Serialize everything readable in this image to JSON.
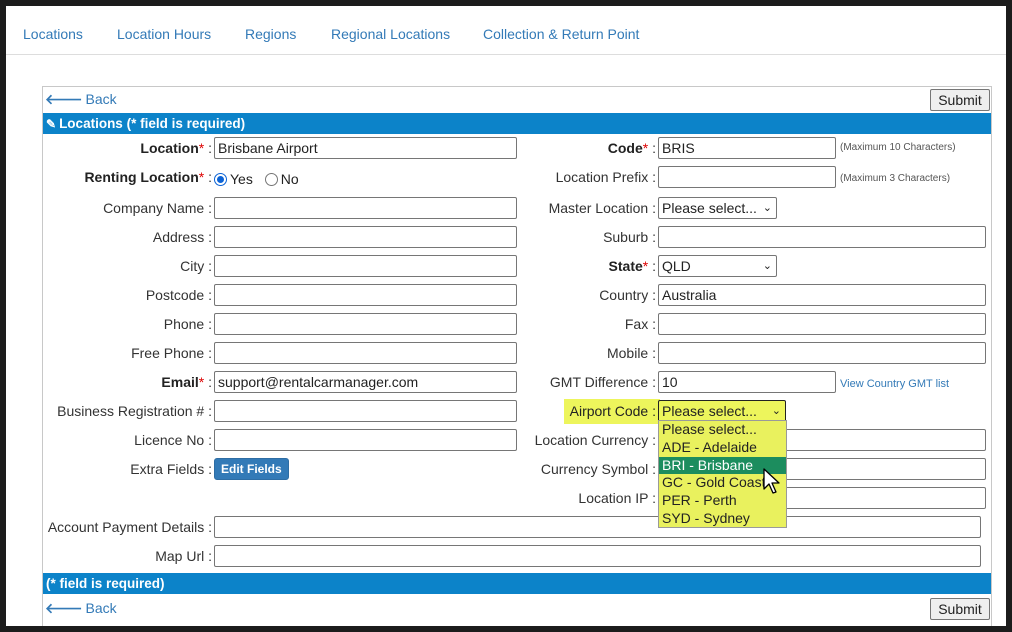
{
  "nav": [
    "Locations",
    "Location Hours",
    "Regions",
    "Regional Locations",
    "Collection & Return Point"
  ],
  "back_label": "Back",
  "submit_label": "Submit",
  "header_bar": "Locations (* field is required)",
  "footer_bar": "(* field is required)",
  "required_marker": "*",
  "left": {
    "location_label": "Location",
    "location_value": "Brisbane Airport",
    "renting_label": "Renting Location",
    "renting_yes": "Yes",
    "renting_no": "No",
    "company_label": "Company Name :",
    "address_label": "Address :",
    "city_label": "City :",
    "postcode_label": "Postcode :",
    "phone_label": "Phone :",
    "free_phone_label": "Free Phone :",
    "email_label": "Email",
    "email_value": "support@rentalcarmanager.com",
    "business_label": "Business Registration # :",
    "licence_label": "Licence No :",
    "extra_label": "Extra Fields :",
    "edit_fields": "Edit Fields",
    "account_label": "Account Payment Details :",
    "map_label": "Map Url :"
  },
  "right": {
    "code_label": "Code",
    "code_value": "BRIS",
    "code_hint": "(Maximum 10 Characters)",
    "prefix_label": "Location Prefix :",
    "prefix_hint": "(Maximum 3 Characters)",
    "master_label": "Master Location :",
    "master_value": "Please select...",
    "suburb_label": "Suburb :",
    "state_label": "State",
    "state_value": "QLD",
    "country_label": "Country :",
    "country_value": "Australia",
    "fax_label": "Fax :",
    "mobile_label": "Mobile :",
    "gmt_label": "GMT Difference :",
    "gmt_value": "10",
    "gmt_link": "View Country GMT list",
    "airport_label": "Airport Code :",
    "airport_value": "Please select...",
    "currency_label": "Location Currency :",
    "currency_symbol_label": "Currency Symbol :",
    "ip_label": "Location IP :"
  },
  "airport_options": [
    "Please select...",
    "ADE - Adelaide",
    "BRI - Brisbane",
    "GC - Gold Coast",
    "PER - Perth",
    "SYD - Sydney"
  ],
  "airport_active_index": 2,
  "colors": {
    "accent_bar": "#0c83c9",
    "link": "#337ab7",
    "highlight": "#edf55c",
    "option_active": "#1c8d5e"
  }
}
